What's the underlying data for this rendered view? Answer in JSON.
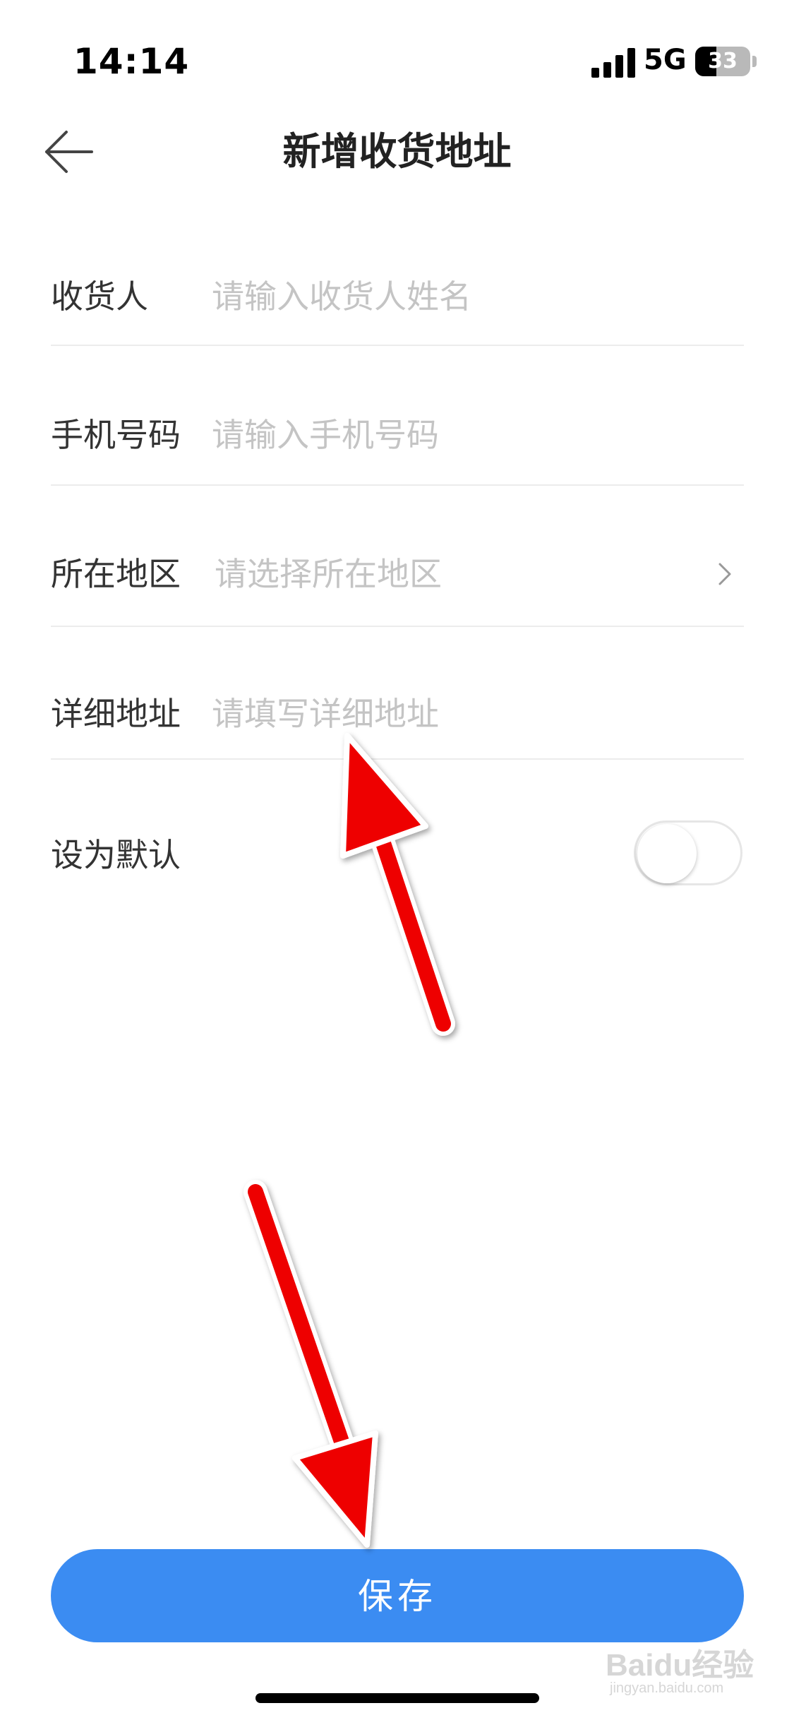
{
  "status_bar": {
    "time": "14:14",
    "network": "5G",
    "battery": "33",
    "icons": [
      "signal-icon",
      "battery-icon"
    ]
  },
  "header": {
    "title": "新增收货地址",
    "back_icon": "back-arrow-icon"
  },
  "form": {
    "recipient": {
      "label": "收货人",
      "placeholder": "请输入收货人姓名"
    },
    "phone": {
      "label": "手机号码",
      "placeholder": "请输入手机号码"
    },
    "region": {
      "label": "所在地区",
      "placeholder": "请选择所在地区",
      "icon": "chevron-right-icon"
    },
    "address": {
      "label": "详细地址",
      "placeholder": "请填写详细地址"
    },
    "default": {
      "label": "设为默认",
      "enabled": false
    }
  },
  "footer": {
    "save_label": "保存"
  },
  "annotations": {
    "arrow_color": "#ee0000",
    "arrow_count": 2
  },
  "watermark": {
    "brand": "Baidu经验",
    "url": "jingyan.baidu.com"
  },
  "colors": {
    "primary": "#3b8cf2",
    "placeholder": "#c4c4c4",
    "divider": "#ececec"
  }
}
